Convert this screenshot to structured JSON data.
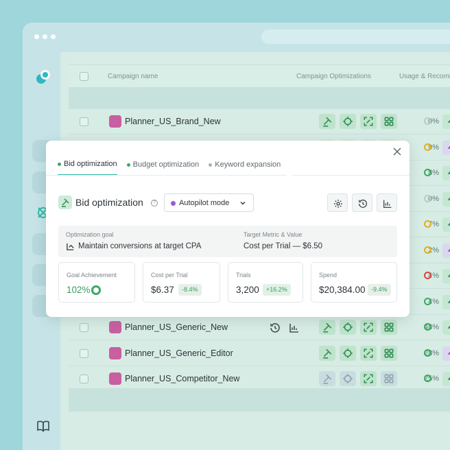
{
  "table": {
    "columns": {
      "campaign_name": "Campaign name",
      "optimizations": "Campaign Optimizations",
      "usage": "Usage & Recomm"
    },
    "rows": [
      {
        "name": "Planner_US_Brand_New",
        "usage": "0%"
      },
      {
        "name": "",
        "usage": "9%"
      },
      {
        "name": "",
        "usage": "8%"
      },
      {
        "name": "",
        "usage": "0%"
      },
      {
        "name": "",
        "usage": "7%"
      },
      {
        "name": "",
        "usage": "2%"
      },
      {
        "name": "",
        "usage": "4%"
      },
      {
        "name": "",
        "usage": "4%"
      },
      {
        "name": "Planner_US_Generic_New",
        "usage": "48%"
      },
      {
        "name": "Planner_US_Generic_Editor",
        "usage": "28%"
      },
      {
        "name": "Planner_US_Competitor_New",
        "usage": "25%"
      }
    ]
  },
  "popover": {
    "tabs": [
      {
        "label": "Bid optimization",
        "dot_color": "#3aa864"
      },
      {
        "label": "Budget optimization",
        "dot_color": "#3aa864"
      },
      {
        "label": "Keyword expansion",
        "dot_color": "#a9b1b4"
      }
    ],
    "title": "Bid optimization",
    "mode": "Autopilot mode",
    "goal_label": "Optimization goal",
    "goal_value": "Maintain conversions at target CPA",
    "target_label": "Target Metric & Value",
    "target_value": "Cost per Trial — $6.50",
    "metrics": [
      {
        "label": "Goal Achievement",
        "value": "102%"
      },
      {
        "label": "Cost per Trial",
        "value": "$6.37",
        "delta": "-8.4%"
      },
      {
        "label": "Trials",
        "value": "3,200",
        "delta": "+16.2%"
      },
      {
        "label": "Spend",
        "value": "$20,384.00",
        "delta": "-9.4%"
      }
    ]
  },
  "colors": {
    "accent": "#2fb8a7",
    "success": "#3aa864",
    "warning": "#e0b020",
    "danger": "#d9443c",
    "app_icon": "#c85fa0"
  },
  "icons": [
    "logo-icon",
    "target-icon",
    "book-icon",
    "gear-icon",
    "close-icon",
    "history-icon",
    "bar-chart-icon",
    "bolt-icon",
    "gavel-icon"
  ]
}
